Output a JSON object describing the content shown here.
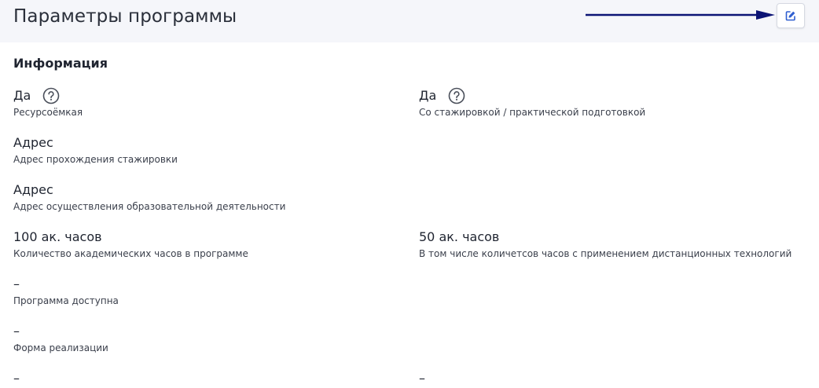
{
  "header": {
    "title": "Параметры программы",
    "edit_icon": "edit-icon",
    "arrow_color": "#0c1475"
  },
  "section": {
    "title": "Информация"
  },
  "fields": {
    "resource": {
      "value": "Да",
      "label": "Ресурсоёмкая",
      "help_icon": "question-circle-icon"
    },
    "internship": {
      "value": "Да",
      "label": "Со стажировкой / практической подготовкой",
      "help_icon": "question-circle-icon"
    },
    "internship_address": {
      "value": "Адрес",
      "label": "Адрес прохождения стажировки"
    },
    "education_address": {
      "value": "Адрес",
      "label": "Адрес осуществления образовательной деятельности"
    },
    "hours_total": {
      "value": "100 ак. часов",
      "label": "Количество академических часов в программе"
    },
    "hours_remote": {
      "value": "50 ак. часов",
      "label": "В том числе количетсов часов с применением дистанционных технологий"
    },
    "availability": {
      "value": "–",
      "label": "Программа доступна"
    },
    "form": {
      "value": "–",
      "label": "Форма реализации"
    },
    "extra_left": {
      "value": "–"
    },
    "extra_right": {
      "value": "–"
    }
  },
  "colors": {
    "accent": "#2f5fd0",
    "header_bg": "#f5f6fa"
  }
}
